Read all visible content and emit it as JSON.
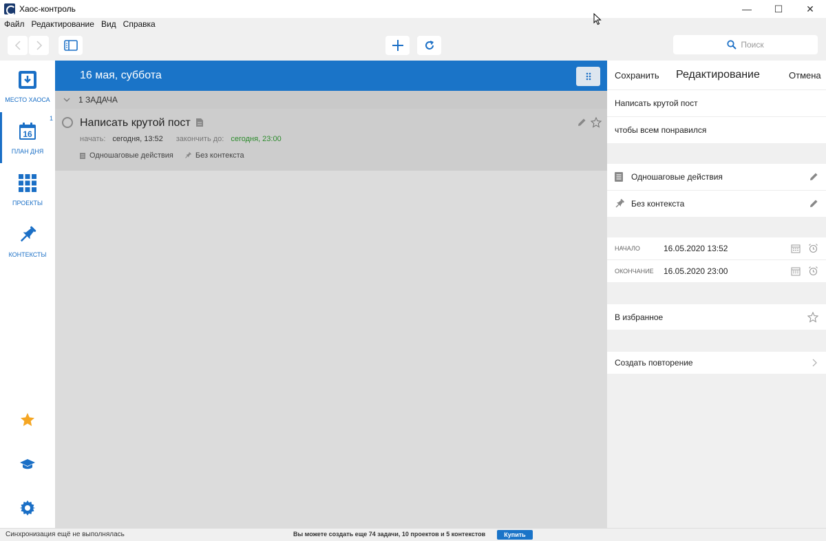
{
  "window": {
    "title": "Хаос-контроль",
    "minimize": "—",
    "maximize": "☐",
    "close": "✕"
  },
  "menu": [
    "Файл",
    "Редактирование",
    "Вид",
    "Справка"
  ],
  "toolbar": {
    "search_placeholder": "Поиск"
  },
  "nav": {
    "items": [
      {
        "label": "Место хаоса",
        "icon": "inbox-download-icon"
      },
      {
        "label": "План дня",
        "icon": "calendar-16-icon",
        "badge": "1",
        "calendar_day": "16"
      },
      {
        "label": "Проекты",
        "icon": "grid-icon"
      },
      {
        "label": "Контексты",
        "icon": "pin-icon"
      }
    ],
    "bottom_icons": [
      "star-icon",
      "graduation-cap-icon",
      "gear-icon"
    ]
  },
  "center": {
    "header_title": "16 мая, суббота",
    "group_title": "1 ЗАДАЧА",
    "task": {
      "title": "Написать крутой пост",
      "start_label": "начать:",
      "start_value": "сегодня, 13:52",
      "end_label": "закончить до:",
      "end_value": "сегодня, 23:00",
      "project": "Одношаговые действия",
      "context": "Без контекста"
    }
  },
  "editor": {
    "save": "Сохранить",
    "title": "Редактирование",
    "cancel": "Отмена",
    "task_title": "Написать крутой пост",
    "task_note": "чтобы всем понравился",
    "project": "Одношаговые действия",
    "context": "Без контекста",
    "start_label": "Начало",
    "start_value": "16.05.2020 13:52",
    "end_label": "Окончание",
    "end_value": "16.05.2020 23:00",
    "favorite": "В избранное",
    "repeat": "Создать повторение"
  },
  "status": {
    "sync": "Синхронизация ещё не выполнялась",
    "promo": "Вы можете создать еще 74 задачи, 10 проектов и 5 контекстов",
    "buy": "Купить"
  },
  "colors": {
    "accent": "#1a74c8",
    "green": "#2a8a2a",
    "star": "#f5a623"
  }
}
